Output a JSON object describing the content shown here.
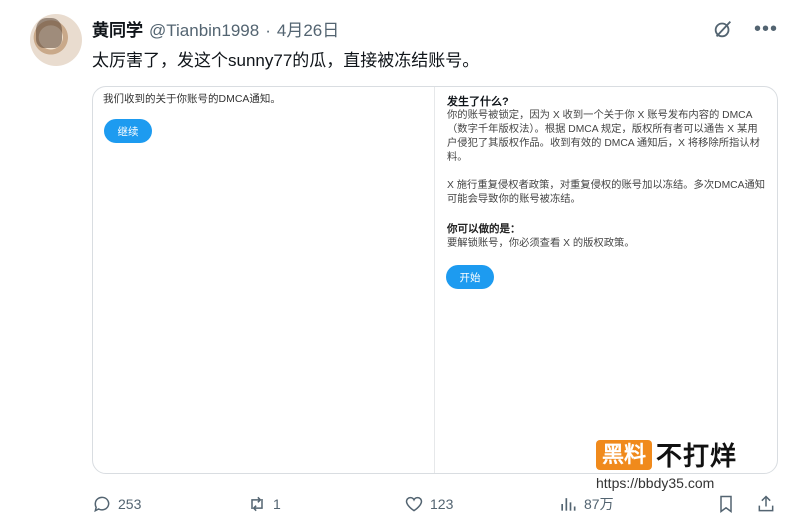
{
  "tweet": {
    "author_name": "黄同学",
    "handle": "@Tianbin1998",
    "separator": "·",
    "date": "4月26日",
    "text": "太厉害了，发这个sunny77的瓜，直接被冻结账号。"
  },
  "card": {
    "left": {
      "notice": "我们收到的关于你账号的DMCA通知。",
      "continue_button": "继续"
    },
    "right": {
      "title": "发生了什么?",
      "para1": "你的账号被锁定，因为 X 收到一个关于你 X 账号发布内容的 DMCA（数字千年版权法）。根据 DMCA 规定，版权所有者可以通告 X 某用户侵犯了其版权作品。收到有效的 DMCA 通知后，X 将移除所指认材料。",
      "para2": "X 施行重复侵权者政策，对重复侵权的账号加以冻结。多次DMCA通知可能会导致你的账号被冻结。",
      "subtitle": "你可以做的是：",
      "para3": "要解锁账号，你必须查看 X 的版权政策。",
      "start_button": "开始"
    }
  },
  "watermark": {
    "badge": "黑料",
    "text": "不打烊",
    "url": "https://bbdy35.com"
  },
  "actions": {
    "replies": "253",
    "retweets": "1",
    "likes": "123",
    "views": "87万"
  },
  "colors": {
    "accent": "#1d9bf0",
    "muted": "#536471",
    "watermark_orange": "#f08a1c"
  }
}
